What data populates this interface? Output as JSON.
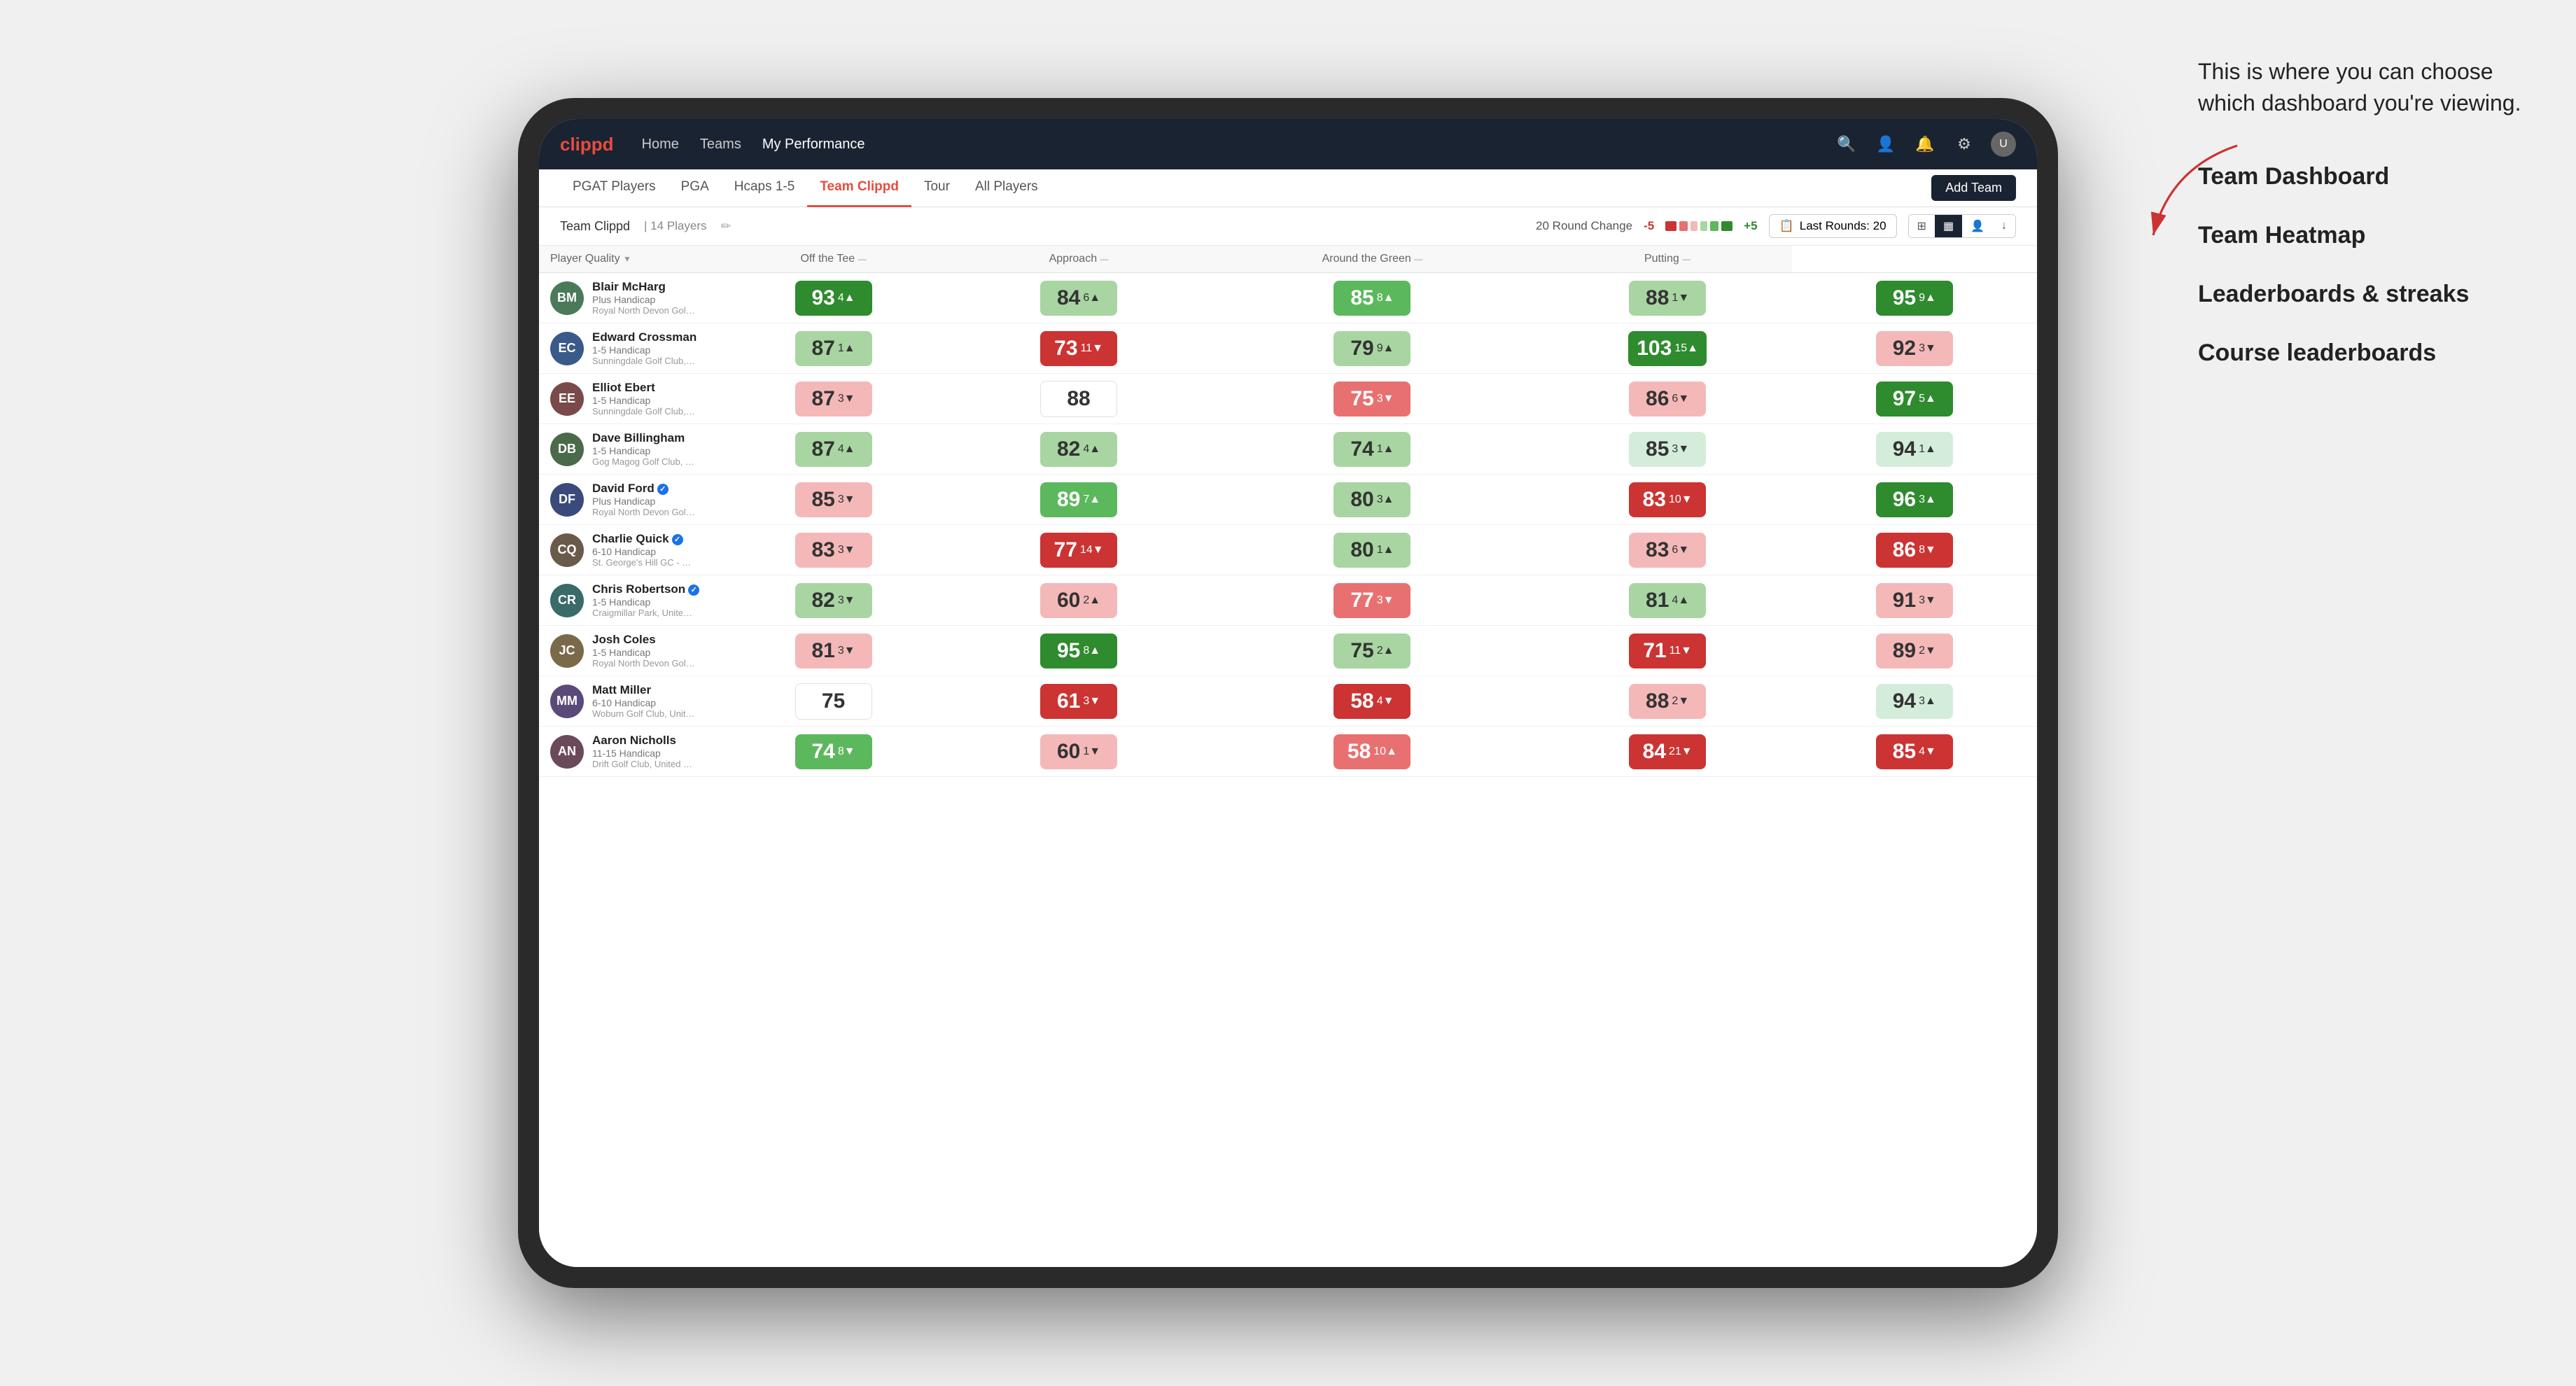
{
  "annotation": {
    "callout": "This is where you can choose which dashboard you're viewing.",
    "items": [
      "Team Dashboard",
      "Team Heatmap",
      "Leaderboards & streaks",
      "Course leaderboards"
    ]
  },
  "nav": {
    "logo": "clippd",
    "links": [
      {
        "label": "Home",
        "active": false
      },
      {
        "label": "Teams",
        "active": false
      },
      {
        "label": "My Performance",
        "active": false
      }
    ]
  },
  "subnav": {
    "links": [
      {
        "label": "PGAT Players",
        "active": false
      },
      {
        "label": "PGA",
        "active": false
      },
      {
        "label": "Hcaps 1-5",
        "active": false
      },
      {
        "label": "Team Clippd",
        "active": true
      },
      {
        "label": "Tour",
        "active": false
      },
      {
        "label": "All Players",
        "active": false
      }
    ],
    "add_team_label": "Add Team"
  },
  "team_header": {
    "name": "Team Clippd",
    "separator": "|",
    "count": "14 Players",
    "round_change_label": "20 Round Change",
    "change_minus": "-5",
    "change_plus": "+5",
    "last_rounds_label": "Last Rounds:",
    "last_rounds_value": "20"
  },
  "table": {
    "columns": [
      {
        "label": "Player Quality",
        "sortable": true
      },
      {
        "label": "Off the Tee",
        "sortable": true
      },
      {
        "label": "Approach",
        "sortable": true
      },
      {
        "label": "Around the Green",
        "sortable": true
      },
      {
        "label": "Putting",
        "sortable": true
      }
    ],
    "players": [
      {
        "name": "Blair McHarg",
        "handicap": "Plus Handicap",
        "club": "Royal North Devon Golf Club, United Kingdom",
        "avatar_color": "#7a9e7a",
        "avatar_initials": "BM",
        "verified": false,
        "scores": [
          {
            "value": 93,
            "delta": 4,
            "direction": "up",
            "bg": "bg-dark-green"
          },
          {
            "value": 84,
            "delta": 6,
            "direction": "up",
            "bg": "bg-light-green"
          },
          {
            "value": 85,
            "delta": 8,
            "direction": "up",
            "bg": "bg-med-green"
          },
          {
            "value": 88,
            "delta": 1,
            "direction": "down",
            "bg": "bg-light-green"
          },
          {
            "value": 95,
            "delta": 9,
            "direction": "up",
            "bg": "bg-dark-green"
          }
        ]
      },
      {
        "name": "Edward Crossman",
        "handicap": "1-5 Handicap",
        "club": "Sunningdale Golf Club, United Kingdom",
        "avatar_color": "#5a7a9a",
        "avatar_initials": "EC",
        "verified": false,
        "scores": [
          {
            "value": 87,
            "delta": 1,
            "direction": "up",
            "bg": "bg-light-green"
          },
          {
            "value": 73,
            "delta": 11,
            "direction": "down",
            "bg": "bg-dark-red"
          },
          {
            "value": 79,
            "delta": 9,
            "direction": "up",
            "bg": "bg-light-green"
          },
          {
            "value": 103,
            "delta": 15,
            "direction": "up",
            "bg": "bg-dark-green"
          },
          {
            "value": 92,
            "delta": 3,
            "direction": "down",
            "bg": "bg-light-red"
          }
        ]
      },
      {
        "name": "Elliot Ebert",
        "handicap": "1-5 Handicap",
        "club": "Sunningdale Golf Club, United Kingdom",
        "avatar_color": "#8a5a5a",
        "avatar_initials": "EE",
        "verified": false,
        "scores": [
          {
            "value": 87,
            "delta": 3,
            "direction": "down",
            "bg": "bg-light-red"
          },
          {
            "value": 88,
            "delta": null,
            "direction": null,
            "bg": "bg-white"
          },
          {
            "value": 75,
            "delta": 3,
            "direction": "down",
            "bg": "bg-med-red"
          },
          {
            "value": 86,
            "delta": 6,
            "direction": "down",
            "bg": "bg-light-red"
          },
          {
            "value": 97,
            "delta": 5,
            "direction": "up",
            "bg": "bg-dark-green"
          }
        ]
      },
      {
        "name": "Dave Billingham",
        "handicap": "1-5 Handicap",
        "club": "Gog Magog Golf Club, United Kingdom",
        "avatar_color": "#6a8a6a",
        "avatar_initials": "DB",
        "verified": false,
        "scores": [
          {
            "value": 87,
            "delta": 4,
            "direction": "up",
            "bg": "bg-light-green"
          },
          {
            "value": 82,
            "delta": 4,
            "direction": "up",
            "bg": "bg-light-green"
          },
          {
            "value": 74,
            "delta": 1,
            "direction": "up",
            "bg": "bg-light-green"
          },
          {
            "value": 85,
            "delta": 3,
            "direction": "down",
            "bg": "bg-very-light-green"
          },
          {
            "value": 94,
            "delta": 1,
            "direction": "up",
            "bg": "bg-very-light-green"
          }
        ]
      },
      {
        "name": "David Ford",
        "handicap": "Plus Handicap",
        "club": "Royal North Devon Golf Club, United Kingdom",
        "avatar_color": "#5a6a8a",
        "avatar_initials": "DF",
        "verified": true,
        "scores": [
          {
            "value": 85,
            "delta": 3,
            "direction": "down",
            "bg": "bg-light-red"
          },
          {
            "value": 89,
            "delta": 7,
            "direction": "up",
            "bg": "bg-med-green"
          },
          {
            "value": 80,
            "delta": 3,
            "direction": "up",
            "bg": "bg-light-green"
          },
          {
            "value": 83,
            "delta": 10,
            "direction": "down",
            "bg": "bg-dark-red"
          },
          {
            "value": 96,
            "delta": 3,
            "direction": "up",
            "bg": "bg-dark-green"
          }
        ]
      },
      {
        "name": "Charlie Quick",
        "handicap": "6-10 Handicap",
        "club": "St. George's Hill GC - Weybridge - Surrey, Uni...",
        "avatar_color": "#7a6a5a",
        "avatar_initials": "CQ",
        "verified": true,
        "scores": [
          {
            "value": 83,
            "delta": 3,
            "direction": "down",
            "bg": "bg-light-red"
          },
          {
            "value": 77,
            "delta": 14,
            "direction": "down",
            "bg": "bg-dark-red"
          },
          {
            "value": 80,
            "delta": 1,
            "direction": "up",
            "bg": "bg-light-green"
          },
          {
            "value": 83,
            "delta": 6,
            "direction": "down",
            "bg": "bg-light-red"
          },
          {
            "value": 86,
            "delta": 8,
            "direction": "down",
            "bg": "bg-dark-red"
          }
        ]
      },
      {
        "name": "Chris Robertson",
        "handicap": "1-5 Handicap",
        "club": "Craigmillar Park, United Kingdom",
        "avatar_color": "#5a8a7a",
        "avatar_initials": "CR",
        "verified": true,
        "scores": [
          {
            "value": 82,
            "delta": 3,
            "direction": "down",
            "bg": "bg-light-green"
          },
          {
            "value": 60,
            "delta": 2,
            "direction": "up",
            "bg": "bg-light-red"
          },
          {
            "value": 77,
            "delta": 3,
            "direction": "down",
            "bg": "bg-med-red"
          },
          {
            "value": 81,
            "delta": 4,
            "direction": "up",
            "bg": "bg-light-green"
          },
          {
            "value": 91,
            "delta": 3,
            "direction": "down",
            "bg": "bg-light-red"
          }
        ]
      },
      {
        "name": "Josh Coles",
        "handicap": "1-5 Handicap",
        "club": "Royal North Devon Golf Club, United Kingdom",
        "avatar_color": "#8a7a5a",
        "avatar_initials": "JC",
        "verified": false,
        "scores": [
          {
            "value": 81,
            "delta": 3,
            "direction": "down",
            "bg": "bg-light-red"
          },
          {
            "value": 95,
            "delta": 8,
            "direction": "up",
            "bg": "bg-dark-green"
          },
          {
            "value": 75,
            "delta": 2,
            "direction": "up",
            "bg": "bg-light-green"
          },
          {
            "value": 71,
            "delta": 11,
            "direction": "down",
            "bg": "bg-dark-red"
          },
          {
            "value": 89,
            "delta": 2,
            "direction": "down",
            "bg": "bg-light-red"
          }
        ]
      },
      {
        "name": "Matt Miller",
        "handicap": "6-10 Handicap",
        "club": "Woburn Golf Club, United Kingdom",
        "avatar_color": "#6a5a8a",
        "avatar_initials": "MM",
        "verified": false,
        "scores": [
          {
            "value": 75,
            "delta": null,
            "direction": null,
            "bg": "bg-white"
          },
          {
            "value": 61,
            "delta": 3,
            "direction": "down",
            "bg": "bg-dark-red"
          },
          {
            "value": 58,
            "delta": 4,
            "direction": "down",
            "bg": "bg-dark-red"
          },
          {
            "value": 88,
            "delta": 2,
            "direction": "down",
            "bg": "bg-light-red"
          },
          {
            "value": 94,
            "delta": 3,
            "direction": "up",
            "bg": "bg-very-light-green"
          }
        ]
      },
      {
        "name": "Aaron Nicholls",
        "handicap": "11-15 Handicap",
        "club": "Drift Golf Club, United Kingdom",
        "avatar_color": "#7a5a6a",
        "avatar_initials": "AN",
        "verified": false,
        "scores": [
          {
            "value": 74,
            "delta": 8,
            "direction": "down",
            "bg": "bg-med-green"
          },
          {
            "value": 60,
            "delta": 1,
            "direction": "down",
            "bg": "bg-light-red"
          },
          {
            "value": 58,
            "delta": 10,
            "direction": "up",
            "bg": "bg-med-red"
          },
          {
            "value": 84,
            "delta": 21,
            "direction": "down",
            "bg": "bg-dark-red"
          },
          {
            "value": 85,
            "delta": 4,
            "direction": "down",
            "bg": "bg-dark-red"
          }
        ]
      }
    ]
  }
}
